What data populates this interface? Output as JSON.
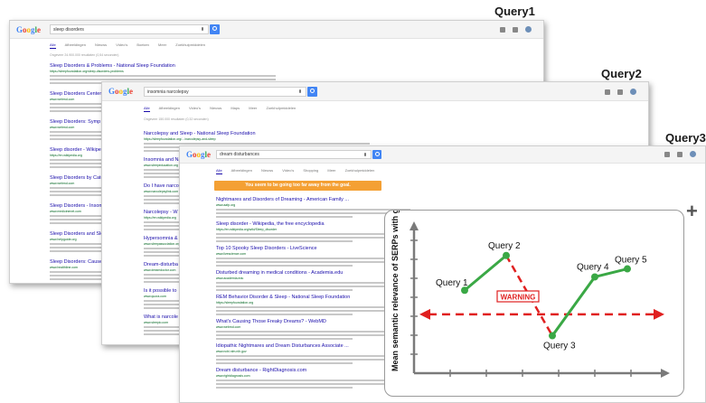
{
  "labels": {
    "q1": "Query1",
    "q2": "Query2",
    "q3": "Query3"
  },
  "windows": [
    {
      "logo": "Google",
      "query": "sleep disorders",
      "tabs": [
        "Alle",
        "Afbeeldingen",
        "Nieuws",
        "Video's",
        "Boeken",
        "Meer",
        "Zoekhulpmiddelen"
      ],
      "stats": "Ongeveer 24.900.000 resultaten (0,54 seconden)",
      "results": [
        {
          "title": "Sleep Disorders & Problems - National Sleep Foundation",
          "url": "https://sleepfoundation.org/sleep-disorders-problems"
        },
        {
          "title": "Sleep Disorders Center",
          "url": "www.webmd.com"
        },
        {
          "title": "Sleep Disorders: Symp",
          "url": "www.webmd.com"
        },
        {
          "title": "Sleep disorder - Wikipedi",
          "url": "https://en.wikipedia.org"
        },
        {
          "title": "Sleep Disorders by Cate",
          "url": "www.webmd.com"
        },
        {
          "title": "Sleep Disorders - Insom",
          "url": "www.medicinenet.com"
        },
        {
          "title": "Sleep Disorders and Sle",
          "url": "www.helpguide.org"
        },
        {
          "title": "Sleep Disorders: Causes",
          "url": "www.healthline.com"
        }
      ]
    },
    {
      "logo": "Google",
      "query": "insomnia narcolepsy",
      "tabs": [
        "Alle",
        "Afbeeldingen",
        "Video's",
        "Nieuws",
        "Maps",
        "Meer",
        "Zoekhulpmiddelen"
      ],
      "stats": "Ongeveer 150.000 resultaten (0,32 seconden)",
      "results": [
        {
          "title": "Narcolepsy and Sleep - National Sleep Foundation",
          "url": "https://sleepfoundation.org/.../narcolepsy-and-sleep"
        },
        {
          "title": "Insomnia and Na",
          "url": "www.sleepeducation.org"
        },
        {
          "title": "Do I have narcol",
          "url": "www.narcolepsylink.com"
        },
        {
          "title": "Narcolepsy - W",
          "url": "https://en.wikipedia.org"
        },
        {
          "title": "Hypersomnia & I",
          "url": "www.sleepassociation.org"
        },
        {
          "title": "Dream-disturba",
          "url": "www.dreamdoctor.com"
        },
        {
          "title": "Is it possible to",
          "url": "www.quora.com"
        },
        {
          "title": "What is narcole",
          "url": "www.sleepio.com"
        }
      ]
    },
    {
      "logo": "Google",
      "query": "dream disturbances",
      "tabs": [
        "Alle",
        "Afbeeldingen",
        "Nieuws",
        "Video's",
        "Shopping",
        "Meer",
        "Zoekhulpmiddelen"
      ],
      "notice": "You seem to be going too far away from the goal.",
      "results": [
        {
          "title": "Nightmares and Disorders of Dreaming - American Family ...",
          "url": "www.aafp.org"
        },
        {
          "title": "Sleep disorder - Wikipedia, the free encyclopedia",
          "url": "https://en.wikipedia.org/wiki/Sleep_disorder"
        },
        {
          "title": "Top 10 Spooky Sleep Disorders - LiveScience",
          "url": "www.livescience.com"
        },
        {
          "title": "Disturbed dreaming in medical conditions - Academia.edu",
          "url": "www.academia.edu"
        },
        {
          "title": "REM Behavior Disorder & Sleep - National Sleep Foundation",
          "url": "https://sleepfoundation.org"
        },
        {
          "title": "What's Causing Those Freaky Dreams? - WebMD",
          "url": "www.webmd.com"
        },
        {
          "title": "Idiopathic Nightmares and Dream Disturbances Associate ...",
          "url": "www.ncbi.nlm.nih.gov"
        },
        {
          "title": "Dream disturbance - RightDiagnosis.com",
          "url": "www.rightdiagnosis.com"
        }
      ]
    }
  ],
  "chart": {
    "ylabel": "Mean semantic relevance of SERPs with goal",
    "warning": "WARNING",
    "colors": {
      "line": "#3aa845",
      "drop": "#e02020",
      "threshold": "#e02020",
      "axis": "#7a7a7a"
    },
    "points": [
      {
        "label": "Query 1",
        "value": 0.62
      },
      {
        "label": "Query 2",
        "value": 0.88
      },
      {
        "label": "Query 3",
        "value": 0.28
      },
      {
        "label": "Query 4",
        "value": 0.72
      },
      {
        "label": "Query 5",
        "value": 0.78
      }
    ],
    "threshold": 0.44
  },
  "plus": "+"
}
